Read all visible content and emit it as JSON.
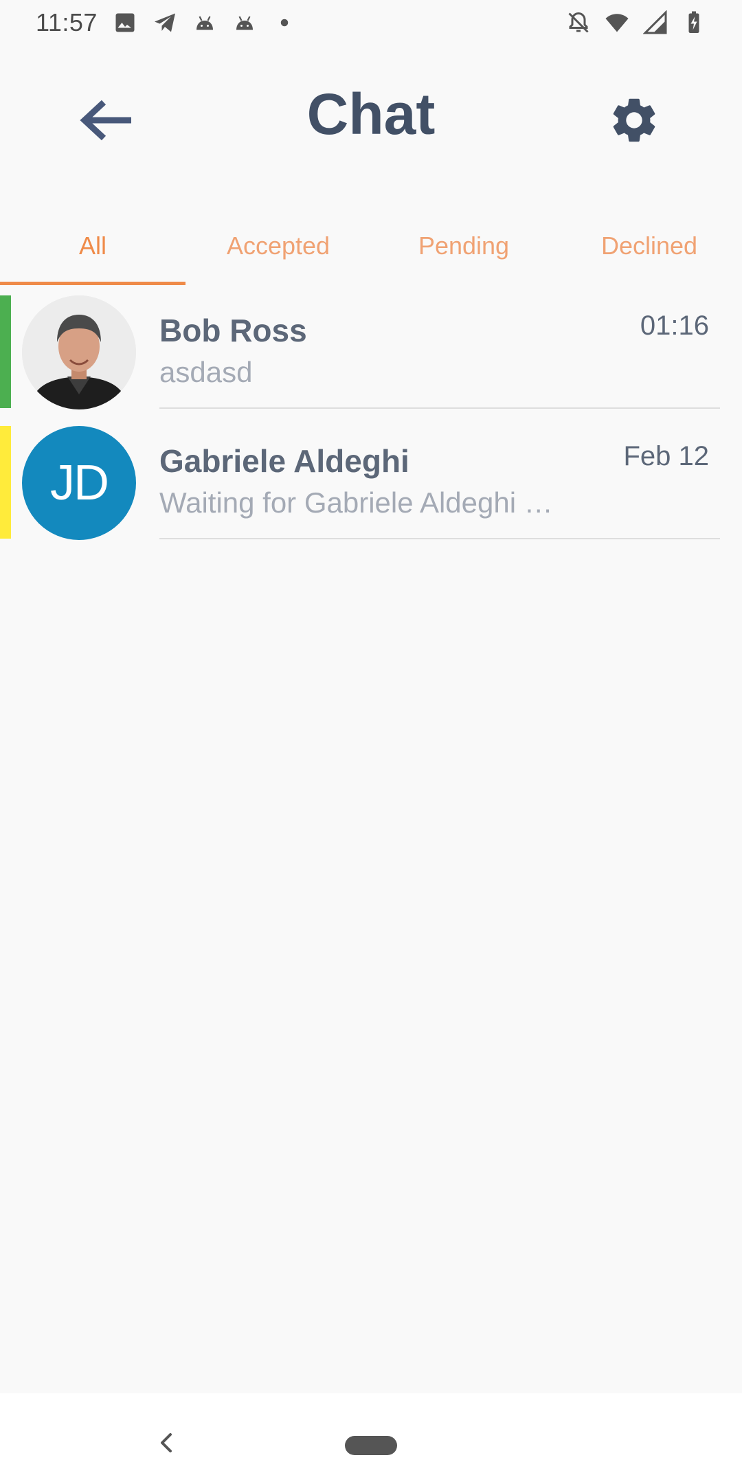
{
  "status_bar": {
    "time": "11:57",
    "left_icons": [
      "image-icon",
      "telegram-icon",
      "android-icon",
      "android-icon",
      "dot-icon"
    ],
    "right_icons": [
      "bell-off-icon",
      "wifi-icon",
      "signal-icon",
      "battery-charging-icon"
    ]
  },
  "header": {
    "title": "Chat",
    "back_icon": "arrow-left-icon",
    "settings_icon": "gear-icon"
  },
  "tabs": [
    {
      "label": "All",
      "active": true
    },
    {
      "label": "Accepted",
      "active": false
    },
    {
      "label": "Pending",
      "active": false
    },
    {
      "label": "Declined",
      "active": false
    }
  ],
  "colors": {
    "accent": "#ef8b49",
    "title": "#425066",
    "accepted_strip": "#4caf50",
    "pending_strip": "#ffeb3b",
    "initials_avatar_bg": "#1389be"
  },
  "chats": [
    {
      "name": "Bob Ross",
      "time": "01:16",
      "preview": "asdasd",
      "status": "accepted",
      "avatar": "photo"
    },
    {
      "name": "Gabriele Aldeghi",
      "time": "Feb 12",
      "preview": "Waiting for Gabriele Aldeghi …",
      "status": "pending",
      "avatar_initials": "JD"
    }
  ],
  "nav_bar": {
    "back_icon": "chevron-left-icon",
    "home_icon": "home-pill-icon"
  }
}
